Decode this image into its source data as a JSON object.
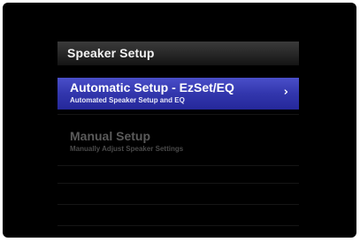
{
  "menu": {
    "title": "Speaker Setup",
    "items": [
      {
        "title": "Automatic Setup - EzSet/EQ",
        "subtitle": "Automated Speaker Setup and EQ",
        "selected": true,
        "icon": "chevron-right-icon",
        "icon_glyph": "›"
      },
      {
        "title": "Manual Setup",
        "subtitle": "Manually Adjust Speaker Settings",
        "selected": false
      }
    ]
  },
  "colors": {
    "background": "#000000",
    "header": "#262626",
    "selected_highlight": "#3236ad",
    "selected_text": "#ffffff",
    "inactive_text": "#5a5a5a"
  }
}
